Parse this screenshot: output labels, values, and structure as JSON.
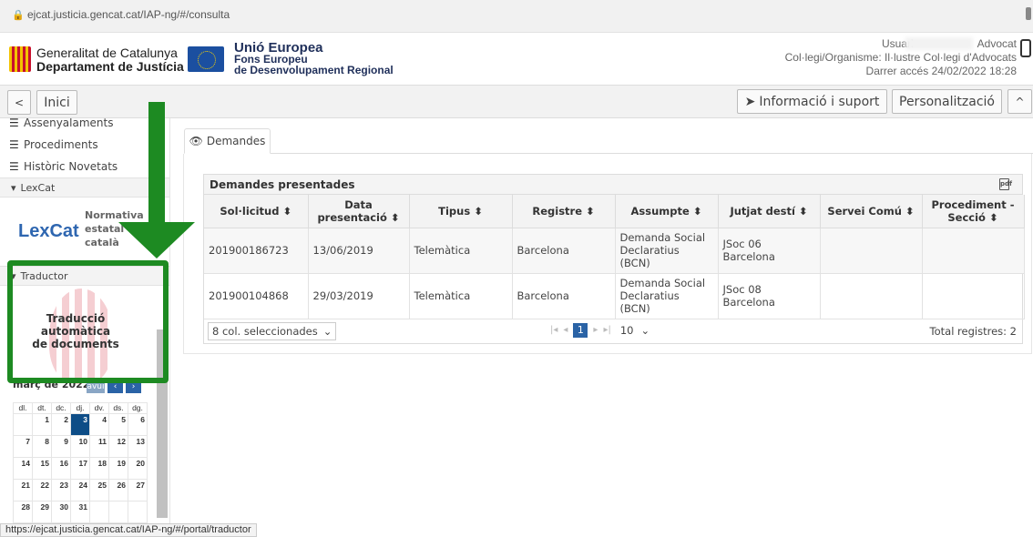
{
  "browser": {
    "url": "ejcat.justicia.gencat.cat/IAP-ng/#/consulta",
    "status_url": "https://ejcat.justicia.gencat.cat/IAP-ng/#/portal/traductor"
  },
  "header": {
    "gen_line1": "Generalitat de Catalunya",
    "gen_line2": "Departament de Justícia",
    "eu_line1": "Unió Europea",
    "eu_line2": "Fons Europeu",
    "eu_line3": "de Desenvolupament Regional",
    "user_label": "Usuari",
    "user_role": "Advocat",
    "org": "Col·legi/Organisme: Il·lustre Col·legi d'Advocats",
    "last_access": "Darrer accés 24/02/2022 18:28"
  },
  "toolbar": {
    "back": "<",
    "inici": "Inici",
    "info": "Informació i suport",
    "pers": "Personalització",
    "collapse": "^"
  },
  "sidebar": {
    "items": [
      {
        "label": "Assenyalaments"
      },
      {
        "label": "Procediments"
      },
      {
        "label": "Històric Novetats"
      }
    ],
    "lexcat_header": "LexCat",
    "lexcat_brand": "LexCat",
    "lexcat_desc": [
      "Normativa",
      "estatal en",
      "català"
    ],
    "traductor_header": "Traductor",
    "traductor_title": [
      "Traducció automàtica",
      "de documents"
    ],
    "calendar": {
      "title": "març de 2022",
      "today_label": "avui",
      "weekdays": [
        "dl.",
        "dt.",
        "dc.",
        "dj.",
        "dv.",
        "ds.",
        "dg."
      ],
      "weeks": [
        [
          "",
          "1",
          "2",
          "3",
          "4",
          "5",
          "6"
        ],
        [
          "7",
          "8",
          "9",
          "10",
          "11",
          "12",
          "13"
        ],
        [
          "14",
          "15",
          "16",
          "17",
          "18",
          "19",
          "20"
        ],
        [
          "21",
          "22",
          "23",
          "24",
          "25",
          "26",
          "27"
        ],
        [
          "28",
          "29",
          "30",
          "31",
          "",
          "",
          ""
        ]
      ],
      "selected": "3"
    }
  },
  "main": {
    "tab_label": "Demandes",
    "table_title": "Demandes presentades",
    "pdf_icon": "pdf",
    "columns": [
      "Sol·licitud ⬍",
      "Data presentació ⬍",
      "Tipus ⬍",
      "Registre ⬍",
      "Assumpte ⬍",
      "Jutjat destí ⬍",
      "Servei Comú ⬍",
      "Procediment - Secció ⬍"
    ],
    "rows": [
      [
        "201900186723",
        "13/06/2019",
        "Telemàtica",
        "Barcelona",
        "Demanda Social Declaratius (BCN)",
        "JSoc 06 Barcelona",
        "",
        ""
      ],
      [
        "201900104868",
        "29/03/2019",
        "Telemàtica",
        "Barcelona",
        "Demanda Social Declaratius (BCN)",
        "JSoc 08 Barcelona",
        "",
        ""
      ]
    ],
    "footer": {
      "col_select": "8 col. seleccionades",
      "current_page": "1",
      "page_size": "10",
      "total": "Total registres: 2"
    }
  },
  "colors": {
    "annotation_green": "#1d8a22",
    "accent_blue": "#2a63a6"
  }
}
